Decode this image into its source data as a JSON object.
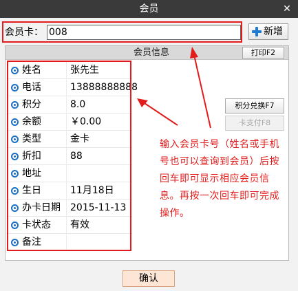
{
  "window": {
    "title": "会员",
    "close_glyph": "✕"
  },
  "card": {
    "label": "会员卡：",
    "value": "008"
  },
  "toolbar": {
    "add_label": "新增",
    "add_icon": "plus-icon"
  },
  "panel": {
    "title": "会员信息",
    "print_label": "打印F2"
  },
  "fields": [
    {
      "label": "姓名",
      "value": "张先生"
    },
    {
      "label": "电话",
      "value": "13888888888"
    },
    {
      "label": "积分",
      "value": "8.0"
    },
    {
      "label": "余额",
      "value": "￥0.00"
    },
    {
      "label": "类型",
      "value": "金卡"
    },
    {
      "label": "折扣",
      "value": "88"
    },
    {
      "label": "地址",
      "value": ""
    },
    {
      "label": "生日",
      "value": "11月18日"
    },
    {
      "label": "办卡日期",
      "value": "2015-11-13"
    },
    {
      "label": "卡状态",
      "value": "有效"
    },
    {
      "label": "备注",
      "value": ""
    }
  ],
  "actions": {
    "points_exchange": "积分兑换F7",
    "card_pay": "卡支付F8"
  },
  "annotation": {
    "text": "输入会员卡号（姓名或手机号也可以查询到会员）后按回车即可显示相应会员信息。再按一次回车即可完成操作。"
  },
  "footer": {
    "confirm_label": "确认"
  },
  "colors": {
    "titlebar": "#3a3a3a",
    "highlight": "#e21c1c",
    "field_dot": "#1b6ec2",
    "confirm_bg": "#fde6d6"
  }
}
